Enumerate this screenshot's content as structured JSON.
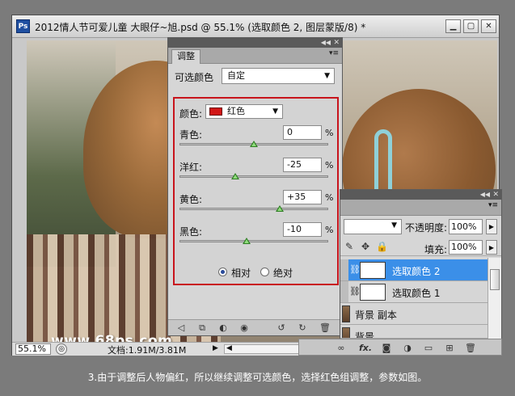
{
  "window": {
    "app_logo": "Ps",
    "title": "2012情人节可爱儿童  大眼仔~旭.psd @ 55.1% (选取颜色 2, 图层蒙版/8) *",
    "minimize": "▁",
    "maximize": "▢",
    "close": "✕"
  },
  "canvas": {
    "watermark": "www.68ps.com"
  },
  "statusbar": {
    "zoom": "55.1%",
    "doc_size": "文档:1.91M/3.81M"
  },
  "adjustments": {
    "tab_label": "调整",
    "title_label": "可选颜色",
    "preset_value": "自定",
    "color_label": "颜色:",
    "color_value": "红色",
    "color_swatch": "#d11515",
    "params": [
      {
        "label": "青色:",
        "value": "0",
        "unit": "%",
        "slider_percent": 0
      },
      {
        "label": "洋红:",
        "value": "-25",
        "unit": "%",
        "slider_percent": -25
      },
      {
        "label": "黄色:",
        "value": "+35",
        "unit": "%",
        "slider_percent": 35
      },
      {
        "label": "黑色:",
        "value": "-10",
        "unit": "%",
        "slider_percent": -10
      }
    ],
    "method_relative": "相对",
    "method_absolute": "绝对",
    "method_selected": "relative",
    "highlight_color": "#c8141c"
  },
  "layers": {
    "opacity_label": "不透明度:",
    "opacity_value": "100%",
    "fill_label": "填充:",
    "fill_value": "100%",
    "items": [
      {
        "name": "选取颜色 2",
        "selected": true
      },
      {
        "name": "选取颜色 1",
        "selected": false
      },
      {
        "name": "背景 副本",
        "selected": false
      },
      {
        "name": "背景",
        "selected": false
      }
    ],
    "footer_fx": "fx.",
    "selection_color": "#3b8fe8"
  },
  "caption": "3.由于调整后人物偏红，所以继续调整可选颜色，选择红色组调整，参数如图。"
}
